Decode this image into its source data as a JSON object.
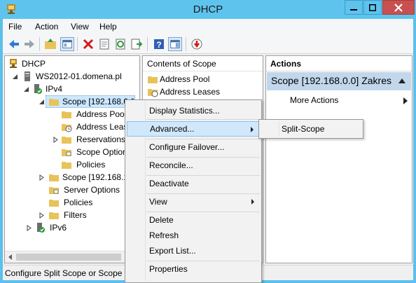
{
  "window": {
    "title": "DHCP"
  },
  "menu": [
    "File",
    "Action",
    "View",
    "Help"
  ],
  "tree": {
    "root": "DHCP",
    "server": "WS2012-01.domena.pl",
    "ipv4": "IPv4",
    "scope1": "Scope [192.168.0.0] Z",
    "scope1_children": [
      "Address Pool",
      "Address Leases",
      "Reservations",
      "Scope Options",
      "Policies"
    ],
    "scope2": "Scope [192.168.1.0] Z",
    "server_options": "Server Options",
    "policies": "Policies",
    "filters": "Filters",
    "ipv6": "IPv6"
  },
  "content": {
    "header": "Contents of Scope",
    "items": [
      "Address Pool",
      "Address Leases"
    ]
  },
  "actions": {
    "header": "Actions",
    "scope": "Scope [192.168.0.0] Zakres",
    "more": "More Actions"
  },
  "context_menu": {
    "items": [
      "Display Statistics...",
      "Advanced...",
      "Configure Failover...",
      "Reconcile...",
      "Deactivate",
      "View",
      "Delete",
      "Refresh",
      "Export List...",
      "Properties"
    ]
  },
  "submenu": {
    "item": "Split-Scope"
  },
  "status": "Configure Split Scope or Scope Options"
}
